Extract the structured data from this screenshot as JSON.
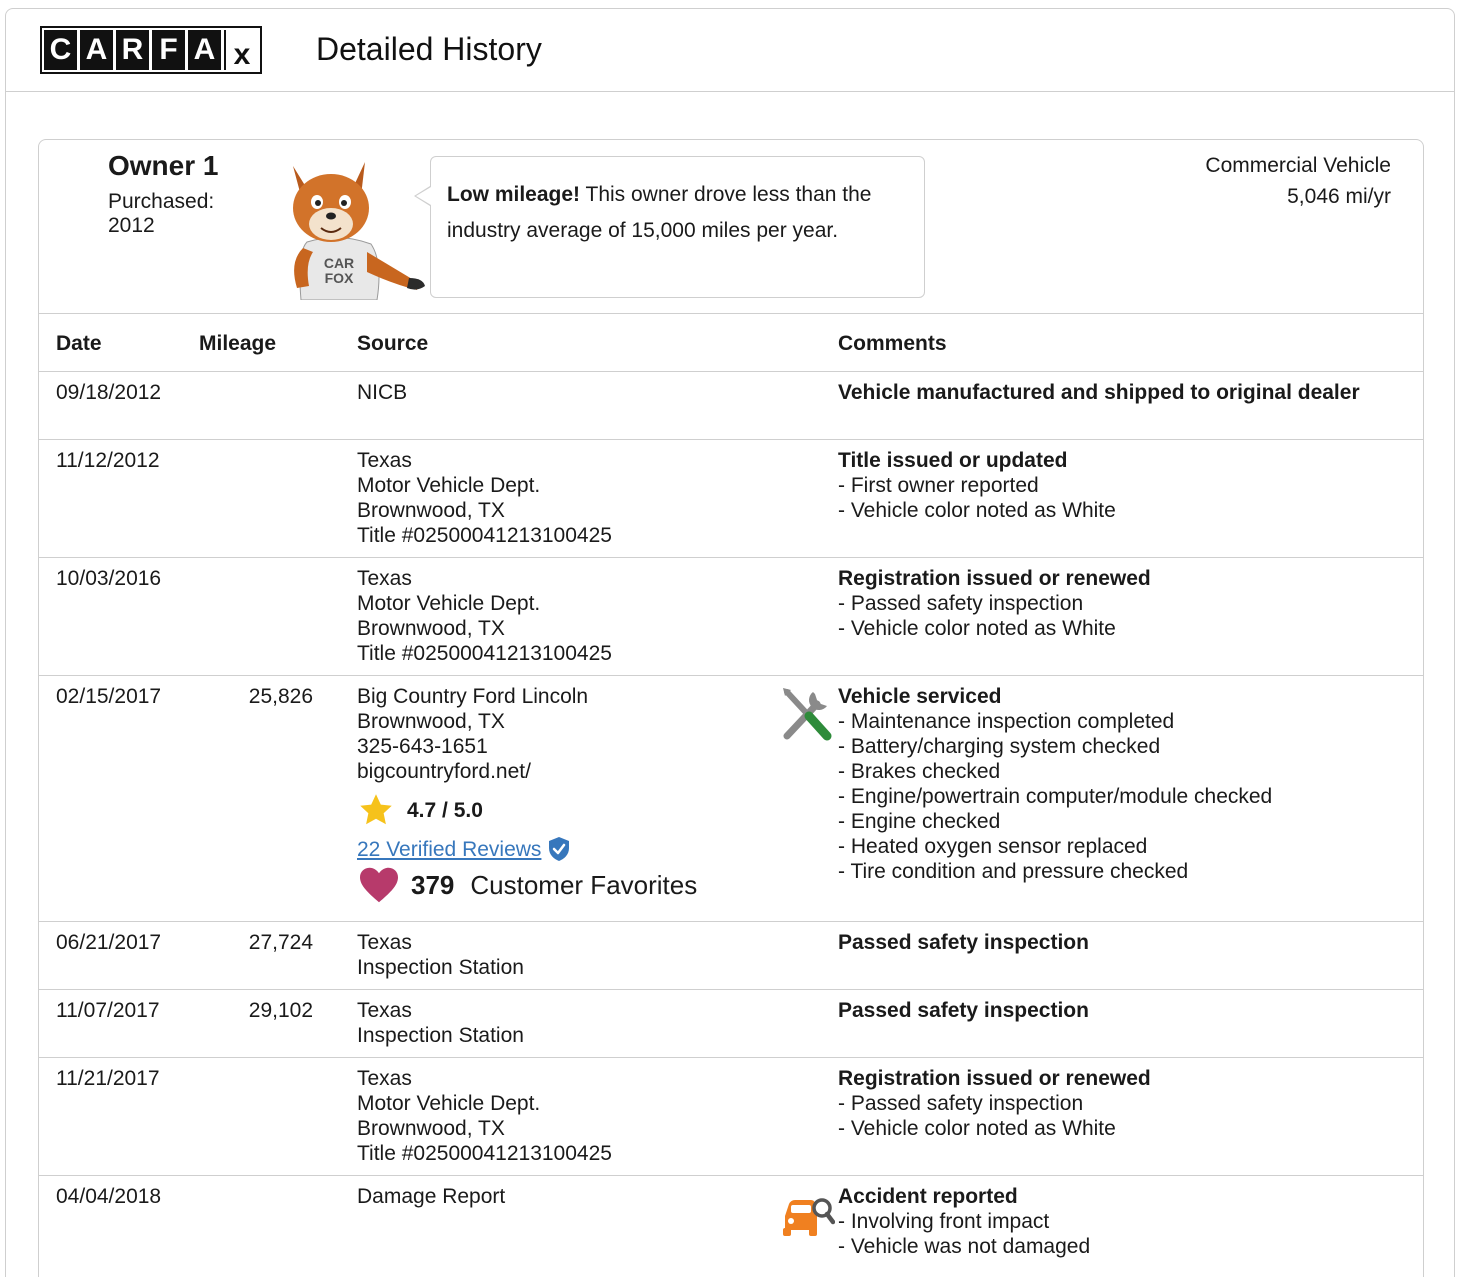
{
  "header": {
    "logo_letters": [
      "C",
      "A",
      "R",
      "F",
      "A"
    ],
    "logo_x": "x",
    "title": "Detailed History"
  },
  "owner": {
    "name": "Owner 1",
    "purchased_label": "Purchased:",
    "purchased_year": "2012",
    "bubble_bold": "Low mileage!",
    "bubble_text": " This owner drove less than the industry average of 15,000 miles per year.",
    "fox_shirt_line1": "CAR",
    "fox_shirt_line2": "FOX",
    "vehicle_type": "Commercial Vehicle",
    "mileage_rate": "5,046 mi/yr"
  },
  "table": {
    "columns": [
      "Date",
      "Mileage",
      "Source",
      "Comments"
    ],
    "rows": [
      {
        "date": "09/18/2012",
        "mileage": "",
        "source": [
          "NICB"
        ],
        "comment_head": "Vehicle manufactured and shipped to original dealer",
        "comments": []
      },
      {
        "date": "11/12/2012",
        "mileage": "",
        "source": [
          "Texas",
          "Motor Vehicle Dept.",
          "Brownwood, TX",
          "Title #02500041213100425"
        ],
        "comment_head": "Title issued or updated",
        "comments": [
          "- First owner reported",
          "- Vehicle color noted as White"
        ]
      },
      {
        "date": "10/03/2016",
        "mileage": "",
        "source": [
          "Texas",
          "Motor Vehicle Dept.",
          "Brownwood, TX",
          "Title #02500041213100425"
        ],
        "comment_head": "Registration issued or renewed",
        "comments": [
          "- Passed safety inspection",
          "- Vehicle color noted as White"
        ]
      },
      {
        "date": "02/15/2017",
        "mileage": "25,826",
        "source": [
          "Big Country Ford Lincoln",
          "Brownwood, TX",
          "325-643-1651",
          "bigcountryford.net/"
        ],
        "rating": "4.7 / 5.0",
        "reviews_link": "22 Verified Reviews",
        "favorites_count": "379",
        "favorites_label": "Customer Favorites",
        "icon": "service-wrench-icon",
        "comment_head": "Vehicle serviced",
        "comments": [
          "- Maintenance inspection completed",
          "- Battery/charging system checked",
          "- Brakes checked",
          "- Engine/powertrain computer/module checked",
          "- Engine checked",
          "- Heated oxygen sensor replaced",
          "- Tire condition and pressure checked"
        ]
      },
      {
        "date": "06/21/2017",
        "mileage": "27,724",
        "source": [
          "Texas",
          "Inspection Station"
        ],
        "comment_head": "Passed safety inspection",
        "comments": []
      },
      {
        "date": "11/07/2017",
        "mileage": "29,102",
        "source": [
          "Texas",
          "Inspection Station"
        ],
        "comment_head": "Passed safety inspection",
        "comments": []
      },
      {
        "date": "11/21/2017",
        "mileage": "",
        "source": [
          "Texas",
          "Motor Vehicle Dept.",
          "Brownwood, TX",
          "Title #02500041213100425"
        ],
        "comment_head": "Registration issued or renewed",
        "comments": [
          "- Passed safety inspection",
          "- Vehicle color noted as White"
        ]
      },
      {
        "date": "04/04/2018",
        "mileage": "",
        "source": [
          "Damage Report"
        ],
        "icon": "accident-car-icon",
        "comment_head": "Accident reported",
        "comments": [
          "- Involving front impact",
          "- Vehicle was not damaged"
        ]
      }
    ]
  },
  "colors": {
    "border": "#cfcfcf",
    "link": "#3777bc",
    "star": "#f6c21b",
    "heart": "#b73a6b",
    "accident": "#f08020",
    "wrench_green": "#2e8b3a"
  }
}
